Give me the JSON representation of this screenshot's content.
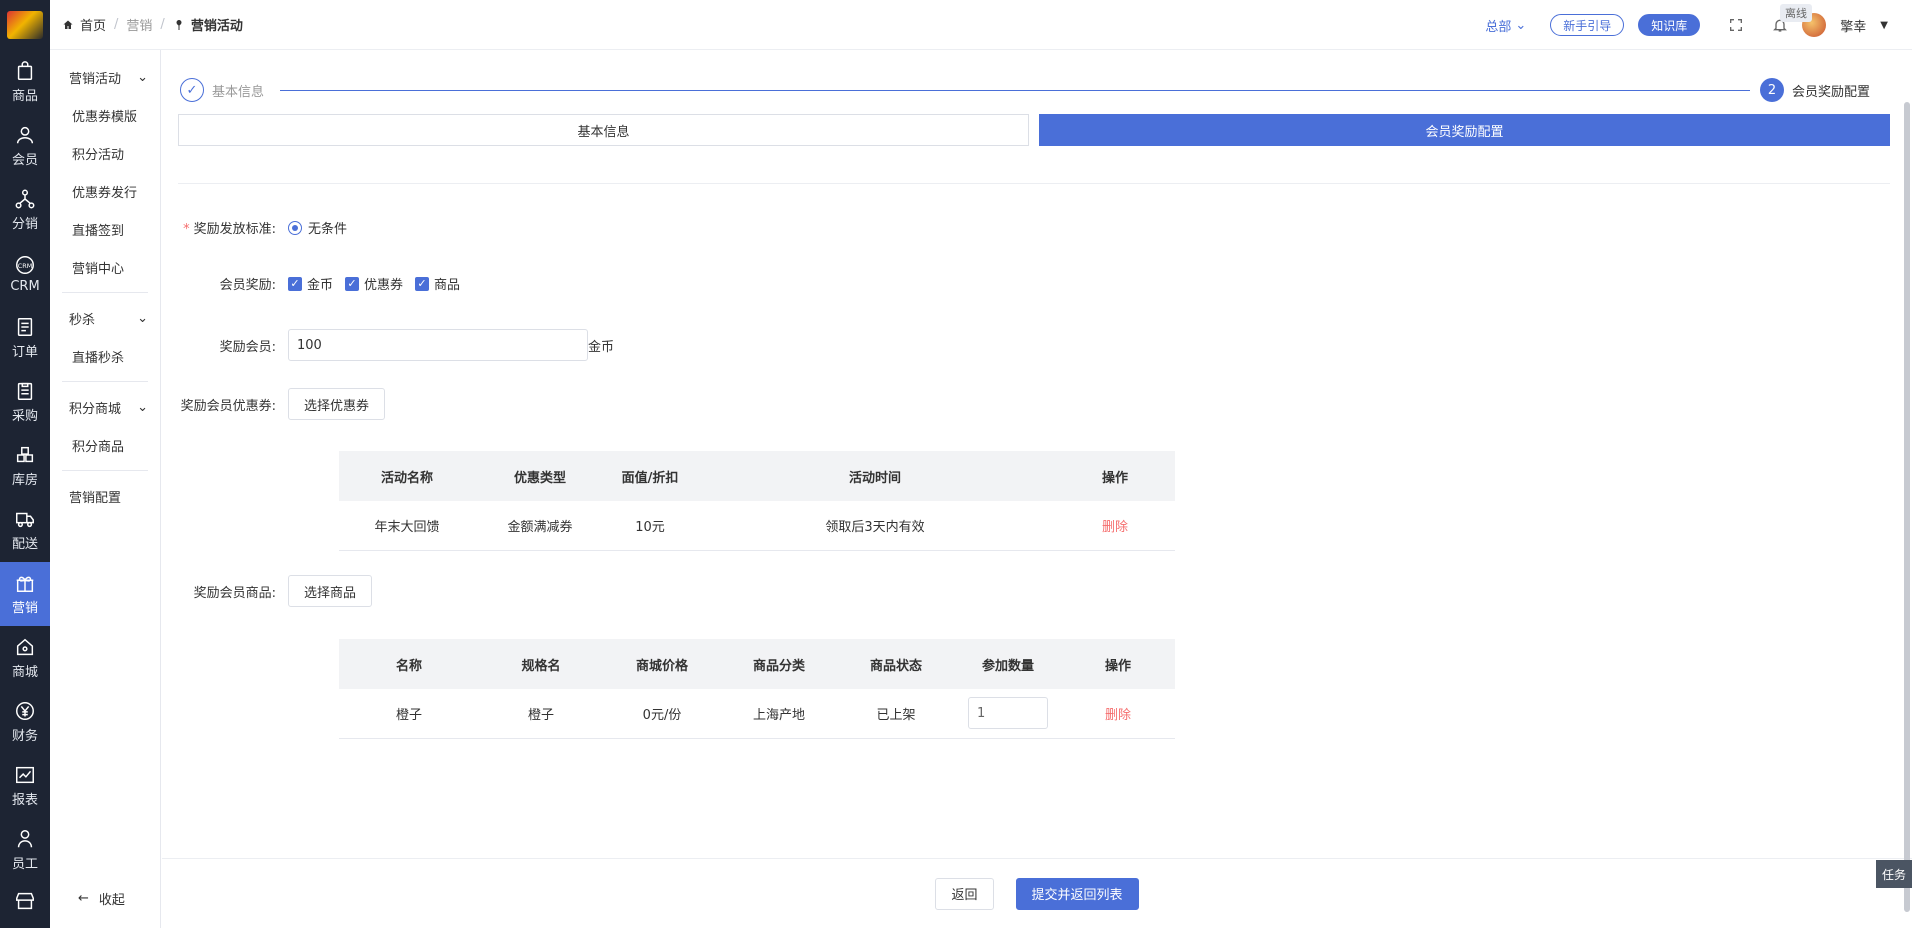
{
  "header": {
    "breadcrumb": [
      "首页",
      "营销",
      "营销活动"
    ],
    "hq_label": "总部",
    "guide_button": "新手引导",
    "kb_button": "知识库",
    "offline_badge": "离线",
    "user_name": "擎幸"
  },
  "rail": {
    "items": [
      "商品",
      "会员",
      "分销",
      "CRM",
      "订单",
      "采购",
      "库房",
      "配送",
      "营销",
      "商城",
      "财务",
      "报表",
      "员工"
    ]
  },
  "subnav": {
    "group1_title": "营销活动",
    "group1_items": [
      "优惠券模版",
      "积分活动",
      "优惠券发行",
      "直播签到",
      "营销中心"
    ],
    "group2_title": "秒杀",
    "group2_items": [
      "直播秒杀"
    ],
    "group3_title": "积分商城",
    "group3_items": [
      "积分商品"
    ],
    "standalone": "营销配置",
    "collapse_label": "收起"
  },
  "steps": {
    "step1": "基本信息",
    "step2_num": "2",
    "step2": "会员奖励配置"
  },
  "tabs": [
    "基本信息",
    "会员奖励配置"
  ],
  "form": {
    "criteria_label": "奖励发放标准:",
    "criteria_value": "无条件",
    "reward_label": "会员奖励:",
    "reward_options": [
      "金币",
      "优惠券",
      "商品"
    ],
    "reward_member_label": "奖励会员:",
    "reward_member_value": "100",
    "reward_member_unit": "金币",
    "coupon_label": "奖励会员优惠券:",
    "coupon_button": "选择优惠券",
    "goods_label": "奖励会员商品:",
    "goods_button": "选择商品"
  },
  "coupon_table": {
    "headers": [
      "活动名称",
      "优惠类型",
      "面值/折扣",
      "活动时间",
      "操作"
    ],
    "rows": [
      [
        "年末大回馈",
        "金额满减券",
        "10元",
        "领取后3天内有效",
        "删除"
      ]
    ]
  },
  "goods_table": {
    "headers": [
      "名称",
      "规格名",
      "商城价格",
      "商品分类",
      "商品状态",
      "参加数量",
      "操作"
    ],
    "rows": [
      [
        "橙子",
        "橙子",
        "0元/份",
        "上海产地",
        "已上架",
        "1",
        "删除"
      ]
    ]
  },
  "footer": {
    "back": "返回",
    "submit": "提交并返回列表"
  },
  "task_label": "任务",
  "colors": {
    "primary": "#4a6fd8",
    "danger": "#f56c6c",
    "rail": "#1d2433"
  }
}
